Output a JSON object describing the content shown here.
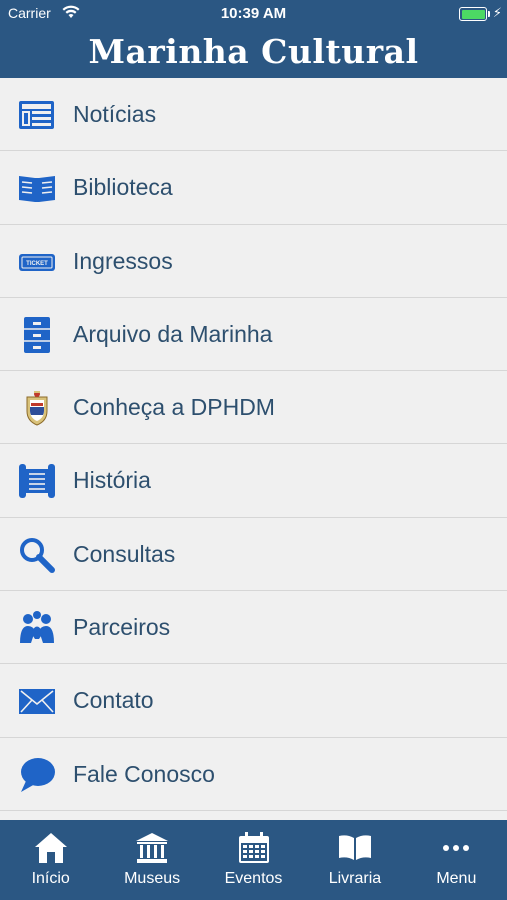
{
  "status_bar": {
    "carrier": "Carrier",
    "time": "10:39 AM"
  },
  "header": {
    "title": "Marinha Cultural"
  },
  "menu": [
    {
      "label": "Notícias",
      "icon": "newspaper-icon"
    },
    {
      "label": "Biblioteca",
      "icon": "open-book-icon"
    },
    {
      "label": "Ingressos",
      "icon": "ticket-icon",
      "icon_text": "TICKET"
    },
    {
      "label": "Arquivo da Marinha",
      "icon": "file-cabinet-icon"
    },
    {
      "label": "Conheça a DPHDM",
      "icon": "navy-crest-icon"
    },
    {
      "label": "História",
      "icon": "scroll-icon"
    },
    {
      "label": "Consultas",
      "icon": "magnifier-icon"
    },
    {
      "label": "Parceiros",
      "icon": "people-icon"
    },
    {
      "label": "Contato",
      "icon": "envelope-icon"
    },
    {
      "label": "Fale Conosco",
      "icon": "chat-bubble-icon"
    }
  ],
  "tabs": [
    {
      "label": "Início",
      "icon": "home-icon"
    },
    {
      "label": "Museus",
      "icon": "museum-icon"
    },
    {
      "label": "Eventos",
      "icon": "calendar-icon"
    },
    {
      "label": "Livraria",
      "icon": "book-icon"
    },
    {
      "label": "Menu",
      "icon": "more-icon"
    }
  ],
  "colors": {
    "header": "#2b5783",
    "icon": "#1f64c7",
    "label": "#2d4f6e",
    "background": "#f0f0f0"
  }
}
